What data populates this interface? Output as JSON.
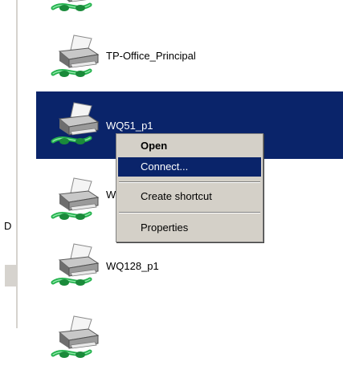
{
  "left_pane": {
    "partial_label": "D"
  },
  "items": [
    {
      "label": ""
    },
    {
      "label": "TP-Office_Principal"
    },
    {
      "label": "WQ51_p1"
    },
    {
      "label": "W"
    },
    {
      "label": "WQ128_p1"
    },
    {
      "label": ""
    }
  ],
  "context_menu": {
    "items": [
      {
        "label": "Open",
        "bold": true
      },
      {
        "label": "Connect...",
        "highlighted": true
      },
      {
        "label": "Create shortcut"
      },
      {
        "label": "Properties"
      }
    ]
  },
  "colors": {
    "selection": "#0a246a",
    "menu_bg": "#d4d0c8",
    "cable_green": "#22b14c"
  },
  "icons": {
    "item_icon": "network-printer-icon"
  }
}
